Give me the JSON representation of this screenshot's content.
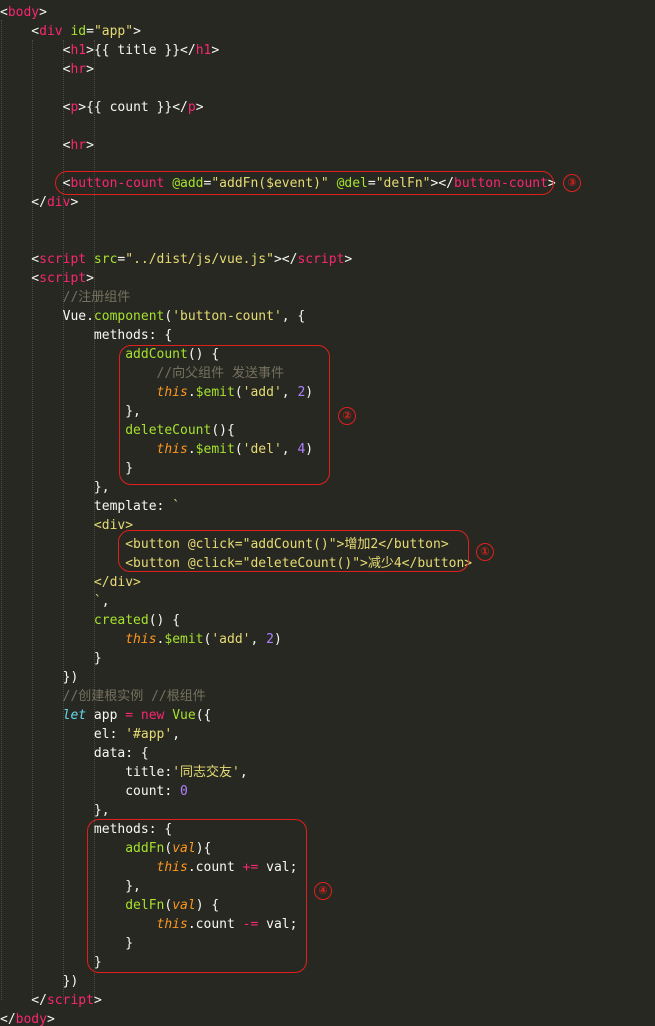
{
  "code_lines": [
    [
      [
        "t-punct",
        "<"
      ],
      [
        "t-tag",
        "body"
      ],
      [
        "t-punct",
        ">"
      ]
    ],
    [
      [
        "t-punct",
        "    <"
      ],
      [
        "t-tag",
        "div"
      ],
      [
        "t-attr",
        " id"
      ],
      [
        "t-punct",
        "="
      ],
      [
        "t-str",
        "\"app\""
      ],
      [
        "t-punct",
        ">"
      ]
    ],
    [
      [
        "t-punct",
        "        <"
      ],
      [
        "t-tag",
        "h1"
      ],
      [
        "t-punct",
        ">"
      ],
      [
        "t-text",
        "{{ title }}"
      ],
      [
        "t-punct",
        "</"
      ],
      [
        "t-tag",
        "h1"
      ],
      [
        "t-punct",
        ">"
      ]
    ],
    [
      [
        "t-punct",
        "        <"
      ],
      [
        "t-tag",
        "hr"
      ],
      [
        "t-punct",
        ">"
      ]
    ],
    [],
    [
      [
        "t-punct",
        "        <"
      ],
      [
        "t-tag",
        "p"
      ],
      [
        "t-punct",
        ">"
      ],
      [
        "t-text",
        "{{ count }}"
      ],
      [
        "t-punct",
        "</"
      ],
      [
        "t-tag",
        "p"
      ],
      [
        "t-punct",
        ">"
      ]
    ],
    [],
    [
      [
        "t-punct",
        "        <"
      ],
      [
        "t-tag",
        "hr"
      ],
      [
        "t-punct",
        ">"
      ]
    ],
    [],
    [
      [
        "t-punct",
        "        <"
      ],
      [
        "t-tag",
        "button-count"
      ],
      [
        "t-attr",
        " @add"
      ],
      [
        "t-punct",
        "="
      ],
      [
        "t-str",
        "\"addFn($event)\""
      ],
      [
        "t-attr",
        " @del"
      ],
      [
        "t-punct",
        "="
      ],
      [
        "t-str",
        "\"delFn\""
      ],
      [
        "t-punct",
        "></"
      ],
      [
        "t-tag",
        "button-count"
      ],
      [
        "t-punct",
        ">"
      ]
    ],
    [
      [
        "t-punct",
        "    </"
      ],
      [
        "t-tag",
        "div"
      ],
      [
        "t-punct",
        ">"
      ]
    ],
    [],
    [],
    [
      [
        "t-punct",
        "    <"
      ],
      [
        "t-tag",
        "script"
      ],
      [
        "t-attr",
        " src"
      ],
      [
        "t-punct",
        "="
      ],
      [
        "t-str",
        "\"../dist/js/vue.js\""
      ],
      [
        "t-punct",
        "></"
      ],
      [
        "t-tag",
        "script"
      ],
      [
        "t-punct",
        ">"
      ]
    ],
    [
      [
        "t-punct",
        "    <"
      ],
      [
        "t-tag",
        "script"
      ],
      [
        "t-punct",
        ">"
      ]
    ],
    [
      [
        "t-cmt",
        "        //注册组件"
      ]
    ],
    [
      [
        "t-obj",
        "        Vue"
      ],
      [
        "t-punct",
        "."
      ],
      [
        "t-fn",
        "component"
      ],
      [
        "t-punct",
        "("
      ],
      [
        "t-str",
        "'button-count'"
      ],
      [
        "t-punct",
        ", {"
      ]
    ],
    [
      [
        "t-prop",
        "            methods"
      ],
      [
        "t-punct",
        ": {"
      ]
    ],
    [
      [
        "t-fn",
        "                addCount"
      ],
      [
        "t-punct",
        "() {"
      ]
    ],
    [
      [
        "t-cmt",
        "                    //向父组件 发送事件"
      ]
    ],
    [
      [
        "t-this",
        "                    this"
      ],
      [
        "t-punct",
        "."
      ],
      [
        "t-fn",
        "$emit"
      ],
      [
        "t-punct",
        "("
      ],
      [
        "t-str",
        "'add'"
      ],
      [
        "t-punct",
        ", "
      ],
      [
        "t-num",
        "2"
      ],
      [
        "t-punct",
        ")"
      ]
    ],
    [
      [
        "t-punct",
        "                },"
      ]
    ],
    [
      [
        "t-fn",
        "                deleteCount"
      ],
      [
        "t-punct",
        "(){"
      ]
    ],
    [
      [
        "t-this",
        "                    this"
      ],
      [
        "t-punct",
        "."
      ],
      [
        "t-fn",
        "$emit"
      ],
      [
        "t-punct",
        "("
      ],
      [
        "t-str",
        "'del'"
      ],
      [
        "t-punct",
        ", "
      ],
      [
        "t-num",
        "4"
      ],
      [
        "t-punct",
        ")"
      ]
    ],
    [
      [
        "t-punct",
        "                }"
      ]
    ],
    [
      [
        "t-punct",
        "            },"
      ]
    ],
    [
      [
        "t-prop",
        "            template"
      ],
      [
        "t-punct",
        ": "
      ],
      [
        "t-str",
        "`"
      ]
    ],
    [
      [
        "t-str",
        "            <div>"
      ]
    ],
    [
      [
        "t-str",
        "                <button @click=\"addCount()\">增加2</button>"
      ]
    ],
    [
      [
        "t-str",
        "                <button @click=\"deleteCount()\">减少4</button>"
      ]
    ],
    [
      [
        "t-str",
        "            </div>"
      ]
    ],
    [
      [
        "t-str",
        "            `"
      ],
      [
        "t-punct",
        ","
      ]
    ],
    [
      [
        "t-fn",
        "            created"
      ],
      [
        "t-punct",
        "() {"
      ]
    ],
    [
      [
        "t-this",
        "                this"
      ],
      [
        "t-punct",
        "."
      ],
      [
        "t-fn",
        "$emit"
      ],
      [
        "t-punct",
        "("
      ],
      [
        "t-str",
        "'add'"
      ],
      [
        "t-punct",
        ", "
      ],
      [
        "t-num",
        "2"
      ],
      [
        "t-punct",
        ")"
      ]
    ],
    [
      [
        "t-punct",
        "            }"
      ]
    ],
    [
      [
        "t-punct",
        "        })"
      ]
    ],
    [
      [
        "t-cmt",
        "        //创建根实例 //根组件"
      ]
    ],
    [
      [
        "t-kw",
        "        let"
      ],
      [
        "t-obj",
        " app "
      ],
      [
        "t-op",
        "="
      ],
      [
        "t-op",
        " new"
      ],
      [
        "t-fn",
        " Vue"
      ],
      [
        "t-punct",
        "({"
      ]
    ],
    [
      [
        "t-prop",
        "            el"
      ],
      [
        "t-punct",
        ": "
      ],
      [
        "t-str",
        "'#app'"
      ],
      [
        "t-punct",
        ","
      ]
    ],
    [
      [
        "t-prop",
        "            data"
      ],
      [
        "t-punct",
        ": {"
      ]
    ],
    [
      [
        "t-prop",
        "                title"
      ],
      [
        "t-punct",
        ":"
      ],
      [
        "t-str",
        "'同志交友'"
      ],
      [
        "t-punct",
        ","
      ]
    ],
    [
      [
        "t-prop",
        "                count"
      ],
      [
        "t-punct",
        ": "
      ],
      [
        "t-num",
        "0"
      ]
    ],
    [
      [
        "t-punct",
        "            },"
      ]
    ],
    [
      [
        "t-prop",
        "            methods"
      ],
      [
        "t-punct",
        ": {"
      ]
    ],
    [
      [
        "t-fn",
        "                addFn"
      ],
      [
        "t-punct",
        "("
      ],
      [
        "t-param",
        "val"
      ],
      [
        "t-punct",
        "){"
      ]
    ],
    [
      [
        "t-this",
        "                    this"
      ],
      [
        "t-punct",
        ".count "
      ],
      [
        "t-op",
        "+="
      ],
      [
        "t-punct",
        " val;"
      ]
    ],
    [
      [
        "t-punct",
        "                },"
      ]
    ],
    [
      [
        "t-fn",
        "                delFn"
      ],
      [
        "t-punct",
        "("
      ],
      [
        "t-param",
        "val"
      ],
      [
        "t-punct",
        ") {"
      ]
    ],
    [
      [
        "t-this",
        "                    this"
      ],
      [
        "t-punct",
        ".count "
      ],
      [
        "t-op",
        "-="
      ],
      [
        "t-punct",
        " val;"
      ]
    ],
    [
      [
        "t-punct",
        "                }"
      ]
    ],
    [
      [
        "t-punct",
        "            }"
      ]
    ],
    [
      [
        "t-punct",
        "        })"
      ]
    ],
    [
      [
        "t-punct",
        "    </"
      ],
      [
        "t-tag",
        "script"
      ],
      [
        "t-punct",
        ">"
      ]
    ],
    [
      [
        "t-punct",
        "</"
      ],
      [
        "t-tag",
        "body"
      ],
      [
        "t-punct",
        ">"
      ]
    ]
  ],
  "annotations": [
    {
      "id": "annotation-1",
      "label": "①"
    },
    {
      "id": "annotation-2",
      "label": "②"
    },
    {
      "id": "annotation-3",
      "label": "③"
    },
    {
      "id": "annotation-4",
      "label": "④"
    }
  ],
  "colors": {
    "background": "#272822",
    "tag": "#f92672",
    "attribute": "#a6e22e",
    "string": "#e6db74",
    "comment": "#75715e",
    "keyword": "#66d9ef",
    "this": "#fd971f",
    "number": "#ae81ff",
    "annotation": "#e0201c"
  }
}
